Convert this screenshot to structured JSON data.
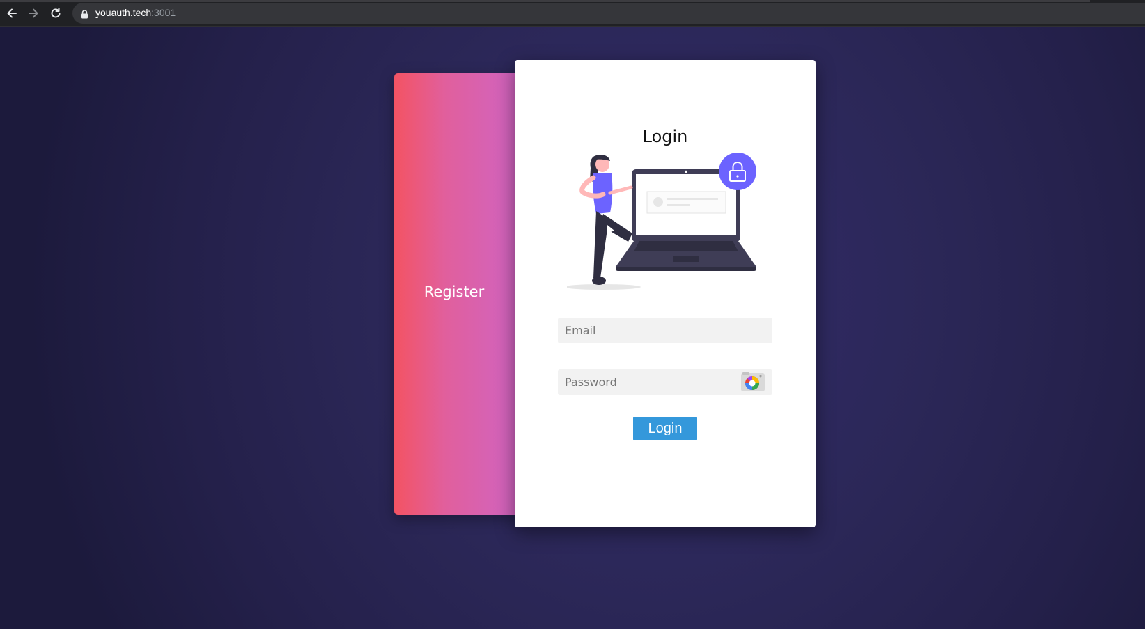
{
  "browser": {
    "url_host": "youauth.tech",
    "url_port": ":3001",
    "icons": [
      "back-arrow-icon",
      "forward-arrow-icon",
      "reload-icon",
      "lock-icon"
    ]
  },
  "register_panel": {
    "label": "Register"
  },
  "login_panel": {
    "title": "Login",
    "email": {
      "placeholder": "Email",
      "value": ""
    },
    "password": {
      "placeholder": "Password",
      "value": ""
    },
    "button_label": "Login"
  },
  "colors": {
    "background": "#2b2757",
    "register_gradient_start": "#f35363",
    "register_gradient_end": "#d064c2",
    "login_button": "#3498db",
    "illustration_accent": "#6c63ff"
  }
}
